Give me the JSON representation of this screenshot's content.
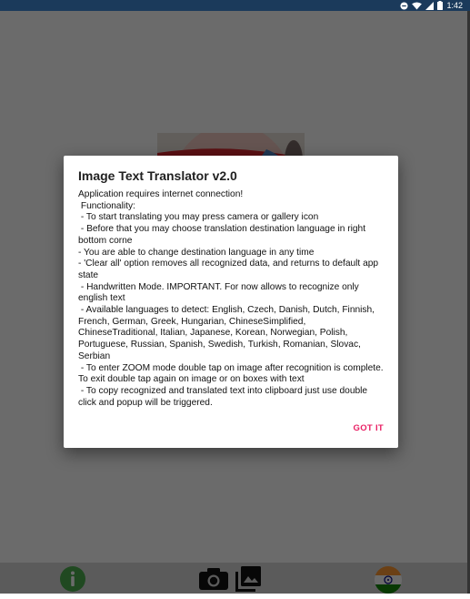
{
  "status_bar": {
    "time": "1:42",
    "icons": [
      "minus-circle-icon",
      "wifi-icon",
      "signal-icon",
      "battery-icon"
    ]
  },
  "bottom_bar": {
    "icons": [
      "info-icon",
      "camera-icon",
      "gallery-icon",
      "language-flag-icon"
    ]
  },
  "dialog": {
    "title": "Image Text Translator v2.0",
    "body": "Application requires internet connection!\n Functionality:\n - To start translating you may press camera or gallery icon\n - Before that you may choose translation destination language in right bottom corne\n- You are able to change destination language in any time\n- 'Clear all' option removes all recognized data, and returns to default app state\n - Handwritten Mode. IMPORTANT. For now allows to recognize only english text\n - Available languages to detect: English, Czech, Danish, Dutch, Finnish, French, German, Greek, Hungarian, ChineseSimplified, ChineseTraditional, Italian, Japanese, Korean, Norwegian, Polish, Portuguese, Russian, Spanish, Swedish, Turkish, Romanian, Slovac, Serbian\n - To enter ZOOM mode double tap on image after recognition is complete. To exit double tap again on image or on boxes with text\n - To copy recognized and translated text into clipboard just use double click and popup will be triggered.",
    "button": "GOT IT"
  },
  "colors": {
    "accent": "#e91e63",
    "status_bar": "#1b3a5b",
    "info_green": "#4caf50"
  }
}
